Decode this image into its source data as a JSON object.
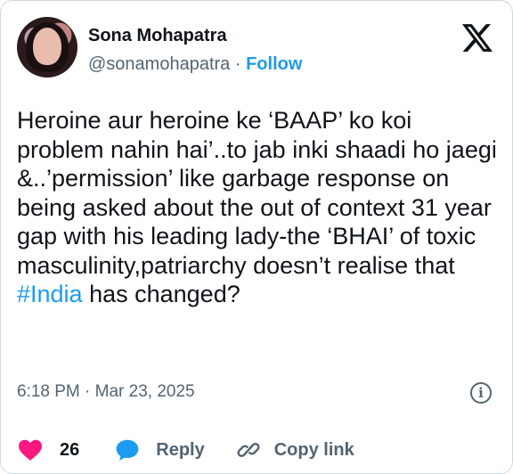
{
  "author": {
    "name": "Sona Mohapatra",
    "handle": "@sonamohapatra",
    "separator": "·",
    "follow_label": "Follow"
  },
  "tweet": {
    "text_before_hashtag": "Heroine aur heroine ke ‘BAAP’ ko koi problem nahin hai’..to jab inki shaadi ho jaegi &..’permission’ like garbage response on being asked about the out of context 31 year gap with his leading lady-the ‘BHAI’ of toxic masculinity,patriarchy doesn’t realise that ",
    "hashtag": "#India",
    "text_after_hashtag": " has changed?"
  },
  "meta": {
    "time": "6:18 PM · Mar 23, 2025",
    "info_glyph": "i"
  },
  "actions": {
    "like_count": "26",
    "reply_label": "Reply",
    "copy_link_label": "Copy link"
  },
  "colors": {
    "accent": "#1d9bf0",
    "like": "#f91880",
    "secondary_text": "#536471",
    "primary_text": "#0f1419"
  },
  "icons": {
    "logo": "x-logo-icon",
    "like": "heart-icon",
    "reply": "speech-bubble-icon",
    "copy": "link-icon",
    "info": "info-icon"
  }
}
